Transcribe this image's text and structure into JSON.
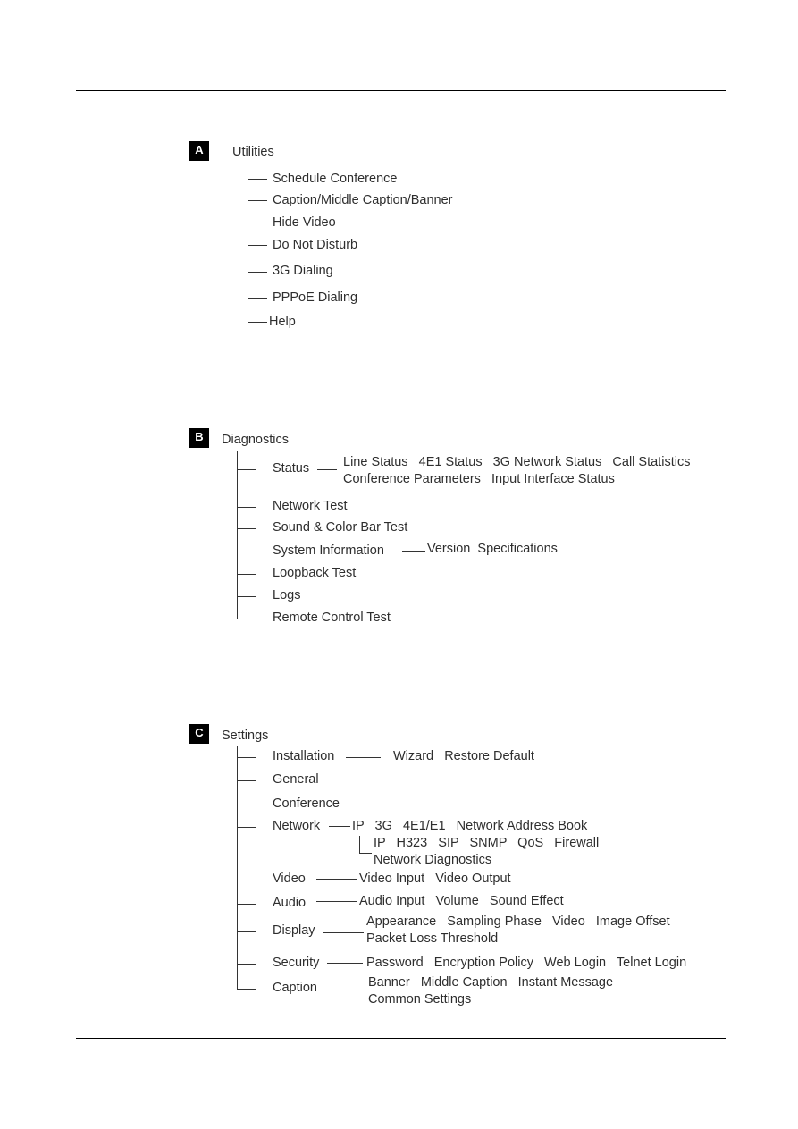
{
  "sections": {
    "a": {
      "badge": "A",
      "title": "Utilities",
      "items": [
        "Schedule Conference",
        "Caption/Middle Caption/Banner",
        "Hide Video",
        "Do Not Disturb",
        "3G Dialing",
        "PPPoE Dialing",
        "Help"
      ]
    },
    "b": {
      "badge": "B",
      "title": "Diagnostics",
      "items": {
        "status": {
          "label": "Status",
          "sub_line1": "Line Status   4E1 Status   3G Network Status   Call Statistics",
          "sub_line2": "Conference Parameters   Input Interface Status"
        },
        "network_test": "Network Test",
        "sound_color": "Sound & Color Bar Test",
        "system_info": {
          "label": "System Information",
          "sub": "Version  Specifications"
        },
        "loopback": "Loopback Test",
        "logs": "Logs",
        "remote": "Remote Control Test"
      }
    },
    "c": {
      "badge": "C",
      "title": "Settings",
      "items": {
        "installation": {
          "label": "Installation",
          "sub": "Wizard   Restore Default"
        },
        "general": "General",
        "conference": "Conference",
        "network": {
          "label": "Network",
          "sub": "IP   3G   4E1/E1   Network Address Book",
          "ip_sub_line1": "IP   H323   SIP   SNMP   QoS   Firewall",
          "ip_sub_line2": "Network Diagnostics"
        },
        "video": {
          "label": "Video",
          "sub": "Video Input   Video Output"
        },
        "audio": {
          "label": "Audio",
          "sub": "Audio Input   Volume   Sound Effect"
        },
        "display": {
          "label": "Display",
          "sub_line1": "Appearance   Sampling Phase   Video   Image Offset",
          "sub_line2": "Packet Loss Threshold"
        },
        "security": {
          "label": "Security",
          "sub": "Password   Encryption Policy   Web Login   Telnet Login"
        },
        "caption": {
          "label": "Caption",
          "sub_line1": "Banner   Middle Caption   Instant Message",
          "sub_line2": "Common Settings"
        }
      }
    }
  }
}
